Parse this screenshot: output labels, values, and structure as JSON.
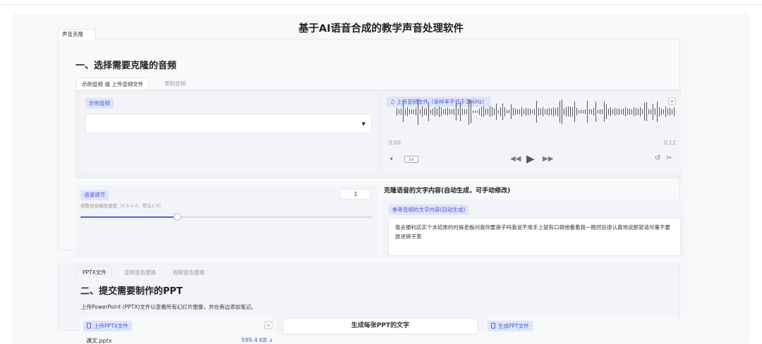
{
  "app": {
    "title": "基于AI语音合成的教学声音处理软件"
  },
  "top_tab": {
    "label": "声音克隆"
  },
  "section1": {
    "title": "一、选择需要克隆的音频",
    "tabs": [
      "示例音频 或 上传音频文件",
      "录制音频"
    ],
    "example_label": "示例音频",
    "example_value": "",
    "upload_label": "上传音频文件（采样率不低于16kHz）",
    "time_start": "0:00",
    "time_end": "0:12",
    "speed_btn": "1x"
  },
  "speed": {
    "label": "语速调节",
    "value": "1",
    "hint": "调整语音播放速度（0.5-2.0，默认1.0）",
    "fraction": 0.33
  },
  "clone_text": {
    "heading": "克隆语音的文字内容(自动生成，可手动修改)",
    "label": "参考音频的文字内容(自动生成)",
    "content": "我去便利店买个水结账的时候老板问我你要袋子吗我说不用手上就有口袋他看着我一眼然后很认真地说那就请尽量不要放进袋子里"
  },
  "bottom_tabs": [
    "PPTX文件",
    "音频音色替换",
    "视频音色替换"
  ],
  "section2": {
    "title": "二、提交需要制作的PPT",
    "description": "上传PowerPoint (PPTX)文件以查看所有幻灯片图像，并在旁边添加笔记。",
    "upload_label": "上传PPTX文件",
    "file_name": "课文.pptx",
    "file_size": "599.4 KB ↓",
    "generate_btn": "生成每张PPT的文字",
    "output_label": "生成PPT文件"
  },
  "icons": {
    "music": "music-icon",
    "file": "file-icon",
    "volume": "volume-icon",
    "rewind": "rewind-icon",
    "play": "play-icon",
    "forward": "fast-forward-icon",
    "undo": "undo-icon",
    "scissors": "scissors-icon"
  },
  "colors": {
    "accent": "#5b5be0",
    "chip_bg": "#dfe3fb",
    "chip_text": "#4a5bd4"
  }
}
